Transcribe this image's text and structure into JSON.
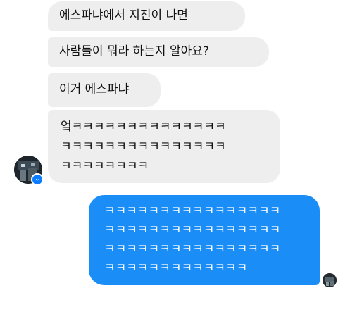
{
  "conversation": {
    "incoming": [
      {
        "text": "에스파냐에서 지진이 나면"
      },
      {
        "text": "사람들이 뭐라 하는지 알아요?"
      },
      {
        "text": "이거 에스파냐"
      },
      {
        "text": "엌ㅋㅋㅋㅋㅋㅋㅋㅋㅋㅋㅋㅋㅋㅋ\nㅋㅋㅋㅋㅋㅋㅋㅋㅋㅋㅋㅋㅋㅋㅋ\nㅋㅋㅋㅋㅋㅋㅋㅋ"
      }
    ],
    "outgoing": [
      {
        "text": "ㅋㅋㅋㅋㅋㅋㅋㅋㅋㅋㅋㅋㅋㅋㅋㅋ\nㅋㅋㅋㅋㅋㅋㅋㅋㅋㅋㅋㅋㅋㅋㅋㅋ\nㅋㅋㅋㅋㅋㅋㅋㅋㅋㅋㅋㅋㅋㅋㅋㅋ\nㅋㅋㅋㅋㅋㅋㅋㅋㅋㅋㅋㅋㅋ"
      }
    ]
  },
  "colors": {
    "incoming_bubble": "#eeeeef",
    "outgoing_bubble": "#1a8df6",
    "messenger_badge": "#0a7cff"
  },
  "icons": {
    "sender_avatar": "profile-photo-avatar",
    "reader_avatar": "profile-photo-avatar",
    "badge": "messenger-icon"
  }
}
